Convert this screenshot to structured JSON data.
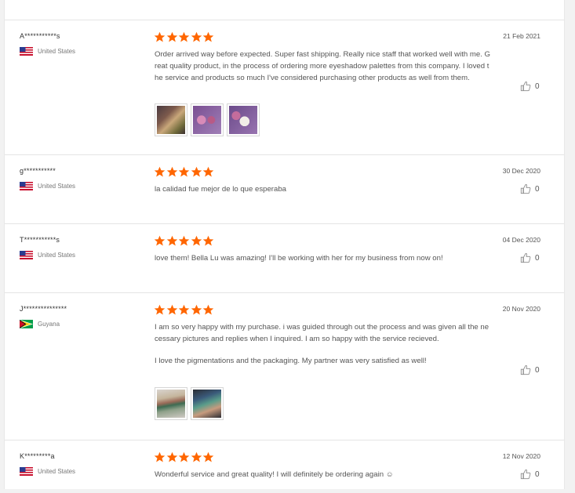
{
  "reviews": [
    {
      "user": "A***********s",
      "country": "United States",
      "flag": "us",
      "rating": 5,
      "date": "21 Feb 2021",
      "paragraphs": [
        "Order arrived way before expected. Super fast shipping. Really nice staff that worked well with me. Great quality product, in the process of ordering more eyeshadow palettes from this company. I loved the service and products so much I've considered purchasing other products as well from them."
      ],
      "likes": "0",
      "photos": [
        "review-photo-eyeshadow-palette",
        "review-photo-pink-palette",
        "review-photo-purple-palette"
      ]
    },
    {
      "user": "g***********",
      "country": "United States",
      "flag": "us",
      "rating": 5,
      "date": "30 Dec 2020",
      "paragraphs": [
        "la calidad fue mejor de lo que esperaba"
      ],
      "likes": "0",
      "photos": []
    },
    {
      "user": "T***********s",
      "country": "United States",
      "flag": "us",
      "rating": 5,
      "date": "04 Dec 2020",
      "paragraphs": [
        "love them! Bella Lu was amazing! I'll be working with her for my business from now on!"
      ],
      "likes": "0",
      "photos": []
    },
    {
      "user": "J***************",
      "country": "Guyana",
      "flag": "gy",
      "rating": 5,
      "date": "20 Nov 2020",
      "paragraphs": [
        "I am so very happy with my purchase. i was guided through out the process and was given all the necessary pictures and replies when I inquired. I am so happy with the service recieved.",
        "I love the pigmentations and the packaging. My partner was very satisfied as well!"
      ],
      "likes": "0",
      "photos": [
        "review-photo-arm-swatches",
        "review-photo-color-swatches"
      ]
    },
    {
      "user": "K*********a",
      "country": "United States",
      "flag": "us",
      "rating": 5,
      "date": "12 Nov 2020",
      "paragraphs": [
        "Wonderful service and great quality! I will definitely be ordering again ☺"
      ],
      "likes": "0",
      "photos": []
    }
  ],
  "colors": {
    "star": "#ff6600",
    "text": "#555555",
    "divider": "#e4e4e4"
  },
  "icons": {
    "rating_star": "star-icon",
    "like": "thumbs-up-icon"
  }
}
